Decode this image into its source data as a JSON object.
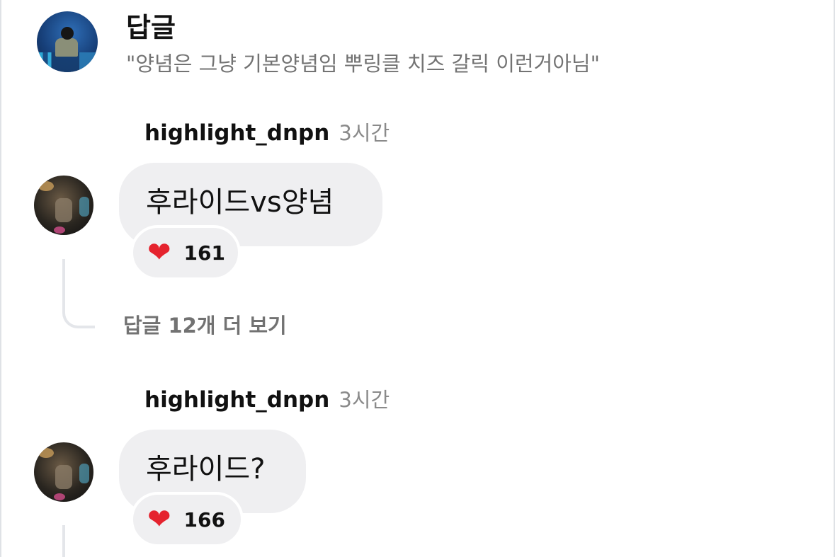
{
  "header": {
    "title": "답글",
    "subtitle": "\"양념은 그냥 기본양념임 뿌링클 치즈 갈릭 이런거아님\""
  },
  "comments": [
    {
      "username": "highlight_dnpn",
      "time": "3시간",
      "text": "후라이드vs양념",
      "like_icon": "heart-icon",
      "likes": "161"
    },
    {
      "username": "highlight_dnpn",
      "time": "3시간",
      "text": "후라이드?",
      "like_icon": "heart-icon",
      "likes": "166"
    }
  ],
  "more_replies_label": "답글 12개 더 보기",
  "colors": {
    "bubble_bg": "#efeff1",
    "muted_text": "#737373",
    "heart": "#e5232e"
  }
}
